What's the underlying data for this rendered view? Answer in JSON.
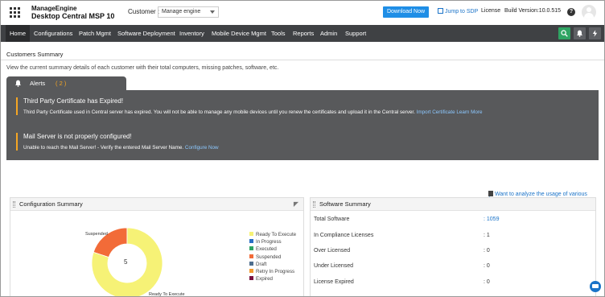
{
  "header": {
    "brand_top": "ManageEngine",
    "brand_name": "Desktop Central MSP 10",
    "customer_label": "Customer :",
    "customer_value": "Manage engine",
    "download_label": "Download Now",
    "jump_sdp_label": "Jump to SDP",
    "license_label": "License",
    "build_label": "Build Version:10.0.515",
    "help_glyph": "?"
  },
  "nav": {
    "items": [
      "Home",
      "Configurations",
      "Patch Mgmt",
      "Software Deployment",
      "Inventory",
      "Mobile Device Mgmt",
      "Tools",
      "Reports",
      "Admin",
      "Support"
    ],
    "active": "Home"
  },
  "summary": {
    "title": "Customers Summary",
    "description": "View the current summary details of each customer with their total computers, missing patches, software, etc."
  },
  "alerts": {
    "tab_label": "Alerts",
    "count": "( 2 )",
    "items": [
      {
        "title": "Third Party Certificate has Expired!",
        "message": "Third Party Certificate used in Central server has expired. You will not be able to manage any mobile devices until you renew the certificates and upload it in the Central server.",
        "link1": "Import Certificate",
        "link2": "Learn More"
      },
      {
        "title": "Mail Server is not properly configured!",
        "message": "Unable to reach the Mail Server! - Verify the entered Mail Server Name.",
        "link1": "Configure Now"
      }
    ]
  },
  "feature_link": "Want to analyze the usage of various features?",
  "config_summary": {
    "title": "Configuration Summary",
    "center_value": "5",
    "label_suspended": "Suspended",
    "label_ready": "Ready To Execute"
  },
  "chart_data": {
    "type": "pie",
    "title": "Configuration Summary",
    "total": 5,
    "slices": [
      {
        "name": "Ready To Execute",
        "value": 4,
        "color": "#f6f276"
      },
      {
        "name": "Suspended",
        "value": 1,
        "color": "#f26b38"
      }
    ],
    "legend": [
      {
        "name": "Ready To Execute",
        "color": "#f6f276"
      },
      {
        "name": "In Progress",
        "color": "#2a6fc4"
      },
      {
        "name": "Executed",
        "color": "#2fa463"
      },
      {
        "name": "Suspended",
        "color": "#f26b38"
      },
      {
        "name": "Draft",
        "color": "#4e6e8e"
      },
      {
        "name": "Retry In Progress",
        "color": "#f29a2e"
      },
      {
        "name": "Expired",
        "color": "#7a1040"
      }
    ],
    "legend_position": "right"
  },
  "software_summary": {
    "title": "Software Summary",
    "rows": [
      {
        "label": "Total Software",
        "value": ": 1059"
      },
      {
        "label": "In Compliance Licenses",
        "value": ": 1"
      },
      {
        "label": "Over Licensed",
        "value": ": 0"
      },
      {
        "label": "Under Licensed",
        "value": ": 0"
      },
      {
        "label": "License Expired",
        "value": ": 0"
      }
    ]
  }
}
